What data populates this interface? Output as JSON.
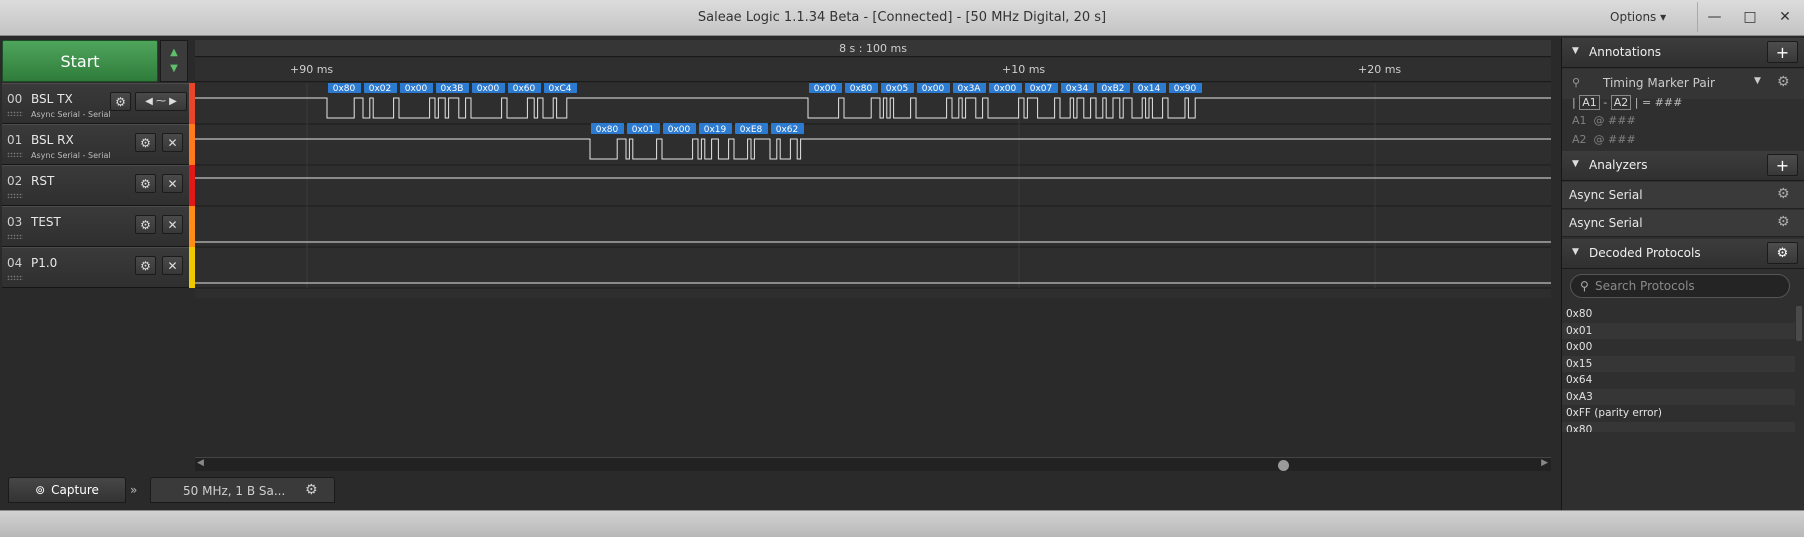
{
  "window": {
    "title": "Saleae Logic 1.1.34 Beta - [Connected] - [50 MHz Digital, 20 s]",
    "options_label": "Options ▾"
  },
  "toolbar": {
    "start_label": "Start"
  },
  "timeline": {
    "center_label": "8 s : 100 ms",
    "ticks": [
      "+90 ms",
      "+10 ms",
      "+20 ms"
    ]
  },
  "channels": [
    {
      "num": "00",
      "name": "BSL TX",
      "sub": "Async Serial - Serial",
      "color": "#e8452a"
    },
    {
      "num": "01",
      "name": "BSL RX",
      "sub": "Async Serial - Serial",
      "color": "#ff7a1a"
    },
    {
      "num": "02",
      "name": "RST",
      "sub": "",
      "color": "#e01818"
    },
    {
      "num": "03",
      "name": "TEST",
      "sub": "",
      "color": "#ff8c14"
    },
    {
      "num": "04",
      "name": "P1.0",
      "sub": "",
      "color": "#f0c800"
    }
  ],
  "decoded_tx": [
    "0x80",
    "0x02",
    "0x00",
    "0x3B",
    "0x00",
    "0x60",
    "0xC4",
    "0x00",
    "0x80",
    "0x05",
    "0x00",
    "0x3A",
    "0x00",
    "0x07",
    "0x34",
    "0xB2",
    "0x14",
    "0x90"
  ],
  "decoded_rx": [
    "0x80",
    "0x01",
    "0x00",
    "0x19",
    "0xE8",
    "0x62"
  ],
  "bottom": {
    "capture_tab": "Capture",
    "session_tab": "50 MHz, 1 B Sa..."
  },
  "sidebar": {
    "annotations_title": "Annotations",
    "timing_marker": "Timing Marker Pair",
    "a1": "A1",
    "a2": "A2",
    "diff_value": "= ###",
    "a1_at": "@  ###",
    "a2_at": "@  ###",
    "analyzers_title": "Analyzers",
    "analyzers": [
      "Async Serial",
      "Async Serial"
    ],
    "decoded_title": "Decoded Protocols",
    "search_placeholder": "Search Protocols",
    "decoded": [
      "0x80",
      "0x01",
      "0x00",
      "0x15",
      "0x64",
      "0xA3",
      "0xFF (parity error)",
      "0x80"
    ]
  }
}
